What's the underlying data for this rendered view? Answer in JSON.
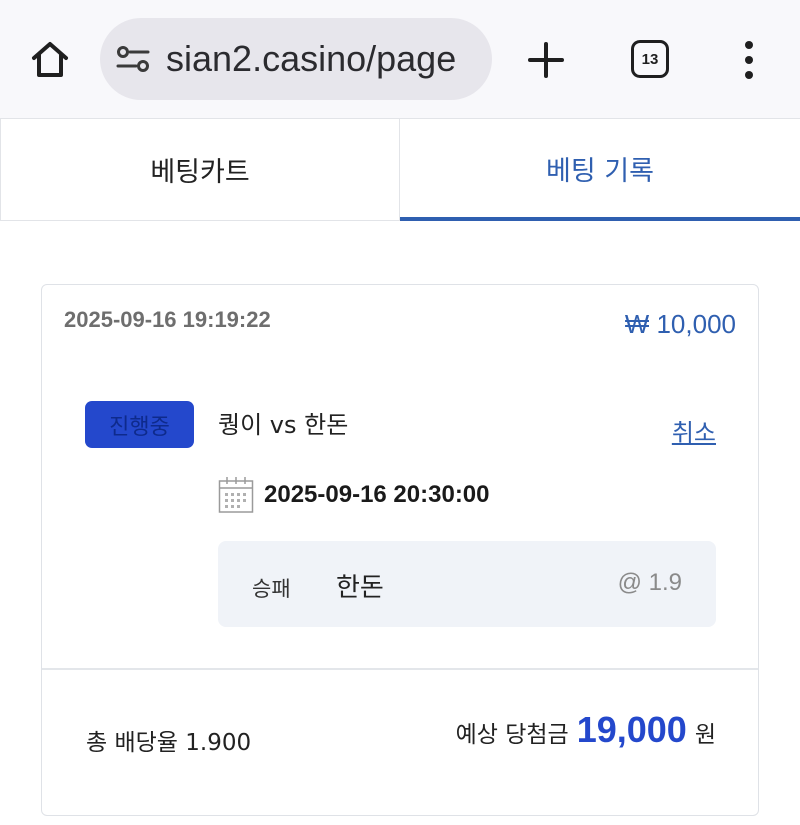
{
  "browser": {
    "url": "sian2.casino/page",
    "tab_count": "13"
  },
  "tabs": [
    {
      "label": "베팅카트",
      "active": false
    },
    {
      "label": "베팅 기록",
      "active": true
    }
  ],
  "bet": {
    "placed_time": "2025-09-16 19:19:22",
    "amount": "₩ 10,000",
    "status": "진행중",
    "match": "퀑이 vs 한돈",
    "cancel_label": "취소",
    "match_time": "2025-09-16 20:30:00",
    "pick": {
      "type": "승패",
      "team": "한돈",
      "odds": "@ 1.9"
    },
    "total_odds": "총 배당율 1.900",
    "expected_label": "예상 당첨금",
    "expected_value": "19,000",
    "expected_unit": "원"
  },
  "colors": {
    "accent": "#2f5fb0",
    "badge": "#2448cc",
    "pick_bg": "#f0f3f8"
  }
}
